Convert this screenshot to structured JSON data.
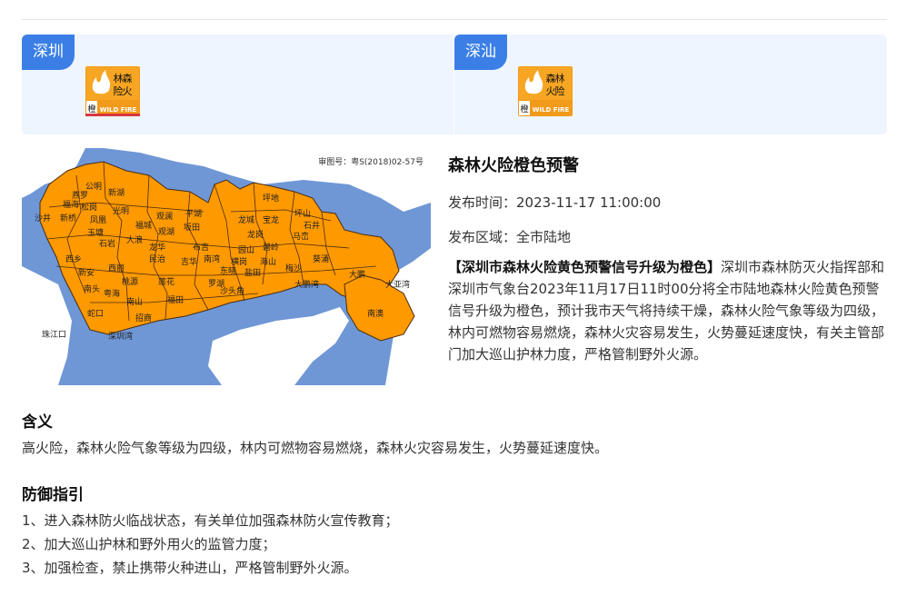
{
  "regions": [
    {
      "name": "深圳",
      "icon": {
        "chars": [
          "森",
          "林",
          "火",
          "险"
        ],
        "level_char": "橙",
        "badge_text": "WILD FIRE"
      }
    },
    {
      "name": "深汕",
      "icon": {
        "chars": [
          "森",
          "林",
          "火",
          "险"
        ],
        "level_char": "橙",
        "badge_text": "WILD FIRE"
      }
    }
  ],
  "map": {
    "review_code": "审图号：粤S(2018)02-57号",
    "places": [
      "公明",
      "新湖",
      "光明",
      "沙井",
      "福海",
      "新桥",
      "松岗",
      "燕罗",
      "凤凰",
      "玉塘",
      "石岩",
      "福城",
      "观澜",
      "观湖",
      "民治",
      "龙华",
      "大浪",
      "西乡",
      "新安",
      "西丽",
      "桃源",
      "粤海",
      "南山",
      "南头",
      "福田",
      "罗湖",
      "坂田",
      "布吉",
      "吉华",
      "南湾",
      "平湖",
      "龙城",
      "龙岗",
      "坪地",
      "坪山",
      "石井",
      "马峦",
      "园山",
      "宝龙",
      "横岗",
      "碧岭",
      "葵涌",
      "大鹏",
      "南澳",
      "盐田",
      "沙头角",
      "海山",
      "梅沙",
      "东晓",
      "莲花",
      "大鹏湾",
      "大亚湾",
      "珠江口",
      "深圳湾",
      "招商",
      "蛇口"
    ]
  },
  "alert": {
    "title": "森林火险橙色预警",
    "publish_time_label": "发布时间：",
    "publish_time": "2023-11-17 11:00:00",
    "area_label": "发布区域：",
    "area": "全市陆地",
    "headline": "【深圳市森林火险黄色预警信号升级为橙色】",
    "body": "深圳市森林防灭火指挥部和深圳市气象台2023年11月17日11时00分将全市陆地森林火险黄色预警信号升级为橙色，预计我市天气将持续干燥，森林火险气象等级为四级，林内可燃物容易燃烧，森林火灾容易发生，火势蔓延速度快，有关主管部门加大巡山护林力度，严格管制野外火源。"
  },
  "meaning": {
    "heading": "含义",
    "text": "高火险，森林火险气象等级为四级，林内可燃物容易燃烧，森林火灾容易发生，火势蔓延速度快。"
  },
  "guide": {
    "heading": "防御指引",
    "items": [
      "1、进入森林防火临战状态，有关单位加强森林防火宣传教育；",
      "2、加大巡山护林和野外用火的监管力度；",
      "3、加强检查，禁止携带火种进山，严格管制野外火源。"
    ]
  },
  "colors": {
    "accent": "#3b7fe6",
    "panel": "#eef5ff",
    "sea": "#6f97d6",
    "land_alert": "#ff9900",
    "land_other": "#ffffff",
    "border": "#4a2c10",
    "selected_underline": "#d9363e",
    "icon_bg": "#f29a1a"
  }
}
